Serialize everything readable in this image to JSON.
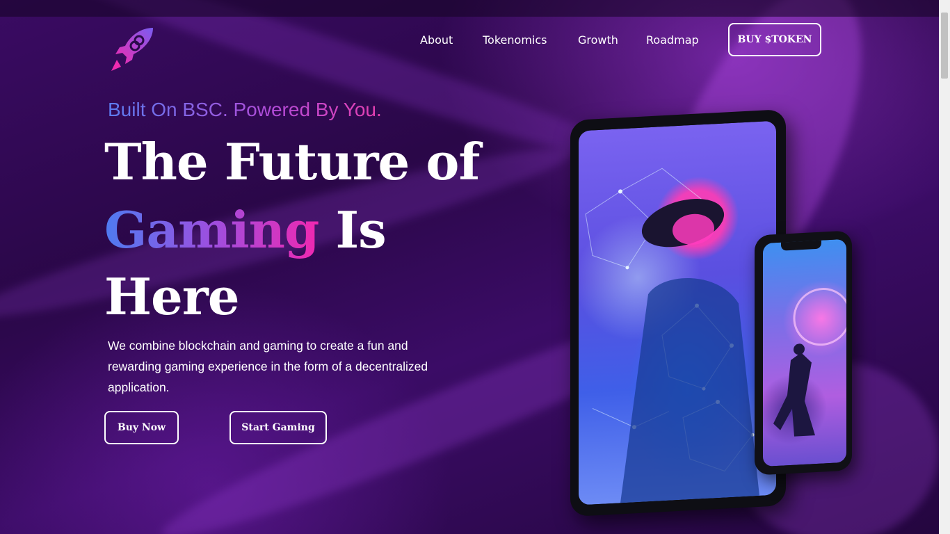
{
  "nav": {
    "items": [
      "About",
      "Tokenomics",
      "Growth",
      "Roadmap"
    ],
    "cta": "BUY $TOKEN"
  },
  "hero": {
    "tagline": "Built On BSC. Powered By You.",
    "line1": "The Future of",
    "highlight": "Gaming",
    "line2_rest": "Is",
    "line3": "Here",
    "description": "We combine blockchain and gaming to create a fun and rewarding gaming experience in the form of a decentralized application.",
    "buy_button": "Buy Now",
    "start_button": "Start Gaming"
  },
  "colors": {
    "accent_blue": "#4e7bf0",
    "accent_purple": "#9d4fe0",
    "accent_pink": "#f028b0",
    "background": "#2a0a4a"
  },
  "icons": {
    "logo": "rocket-infinity-logo"
  }
}
